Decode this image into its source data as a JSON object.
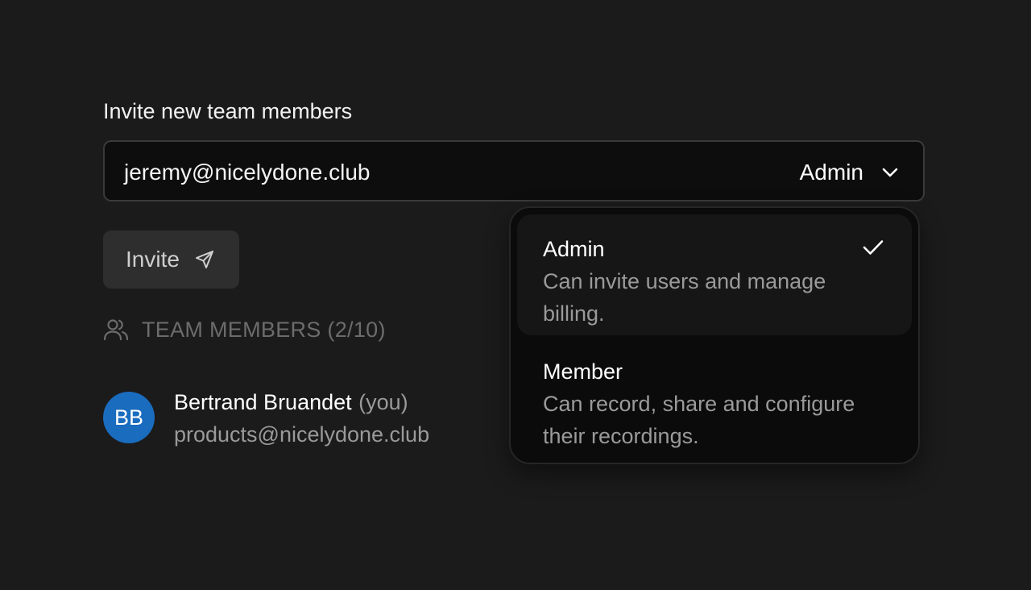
{
  "invite": {
    "title": "Invite new team members",
    "email_value": "jeremy@nicelydone.club",
    "role_value": "Admin",
    "button_label": "Invite"
  },
  "members": {
    "header": "TEAM MEMBERS (2/10)",
    "list": [
      {
        "initials": "BB",
        "name": "Bertrand Bruandet",
        "you_tag": "(you)",
        "email": "products@nicelydone.club"
      }
    ]
  },
  "role_dropdown": {
    "options": [
      {
        "label": "Admin",
        "description": "Can invite users and manage billing.",
        "selected": true
      },
      {
        "label": "Member",
        "description": "Can record, share and configure their recordings.",
        "selected": false
      }
    ]
  },
  "colors": {
    "background": "#1b1b1b",
    "avatar": "#1a6cbe",
    "muted_text": "#9a9a9a"
  },
  "icons": {
    "role_chevron": "chevron-down-icon",
    "invite_button": "send-icon",
    "members_header": "users-icon",
    "selected_option": "check-icon"
  }
}
